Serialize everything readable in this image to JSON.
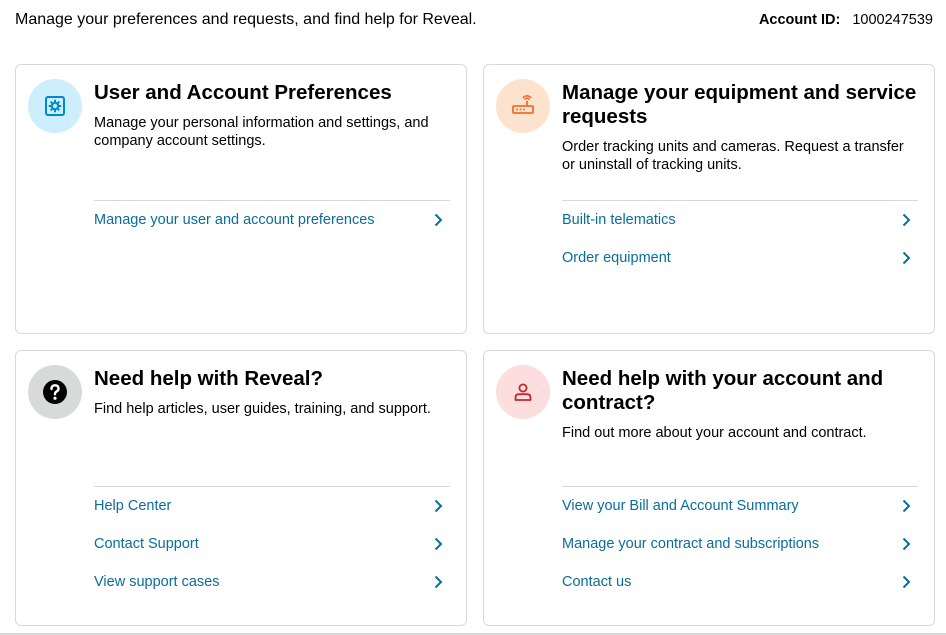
{
  "header": {
    "intro_text": "Manage your preferences and requests, and find help for Reveal.",
    "account_label": "Account ID:",
    "account_value": "1000247539"
  },
  "colors": {
    "link": "#0b6d9a",
    "prefs_icon_bg": "#cdeefc",
    "prefs_icon": "#0088ce",
    "equipment_icon_bg": "#fde2ce",
    "equipment_icon": "#ef6f2e",
    "help_icon_bg": "#d8dada",
    "contract_icon_bg": "#fcdede",
    "contract_icon": "#c0282b"
  },
  "cards": [
    {
      "title": "User and Account Preferences",
      "description": "Manage your personal information and settings, and company account settings.",
      "icon": "settings-gear-icon",
      "links": [
        "Manage your user and account preferences"
      ]
    },
    {
      "title": "Manage your equipment and service requests",
      "description": "Order tracking units and cameras. Request a transfer or uninstall of tracking units.",
      "icon": "router-icon",
      "links": [
        "Built-in telematics",
        "Order equipment"
      ]
    },
    {
      "title": "Need help with Reveal?",
      "description": "Find help articles, user guides, training, and support.",
      "icon": "question-icon",
      "links": [
        "Help Center",
        "Contact Support",
        "View support cases"
      ]
    },
    {
      "title": "Need help with your account and contract?",
      "description": "Find out more about your account and contract.",
      "icon": "person-icon",
      "links": [
        "View your Bill and Account Summary",
        "Manage your contract and subscriptions",
        "Contact us"
      ]
    }
  ]
}
